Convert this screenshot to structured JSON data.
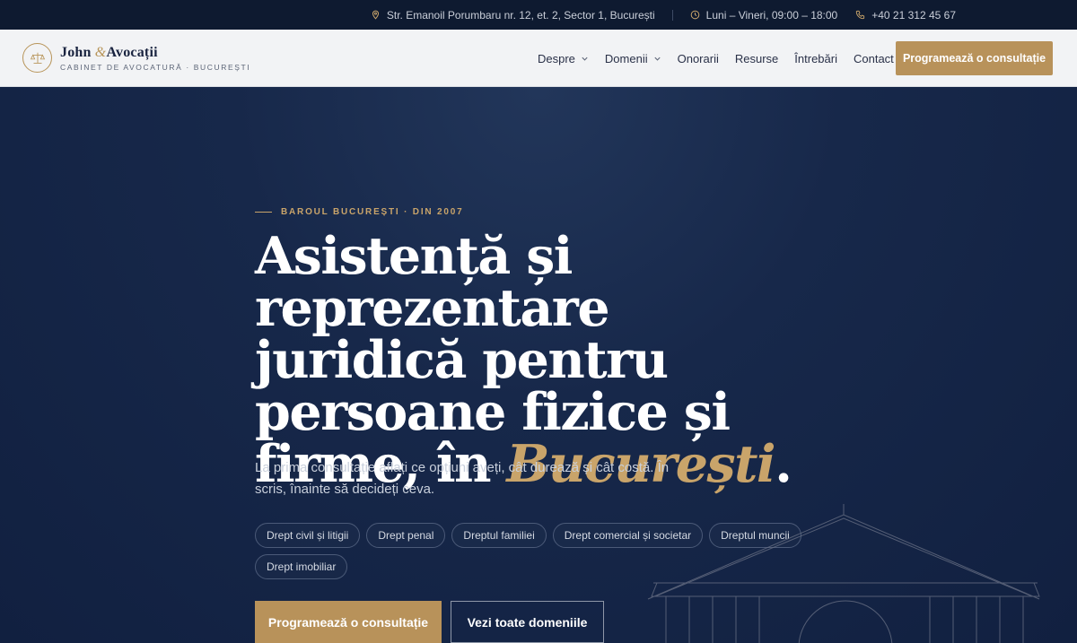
{
  "topbar": {
    "address": "Str. Emanoil Porumbaru nr. 12, et. 2, Sector 1, București",
    "hours": "Luni – Vineri, 09:00 – 18:00",
    "phone": "+40 21 312 45 67"
  },
  "brand": {
    "name_first": "John ",
    "name_amp": "&",
    "name_last": "Avocații",
    "tagline": "CABINET DE AVOCATURĂ · BUCUREȘTI"
  },
  "nav": {
    "items": [
      {
        "label": "Despre",
        "has_dropdown": true
      },
      {
        "label": "Domenii",
        "has_dropdown": true
      },
      {
        "label": "Onorarii",
        "has_dropdown": false
      },
      {
        "label": "Resurse",
        "has_dropdown": false
      },
      {
        "label": "Întrebări",
        "has_dropdown": false
      },
      {
        "label": "Contact",
        "has_dropdown": false
      }
    ],
    "cta": "Programează o consultație"
  },
  "hero": {
    "eyebrow": "BAROUL BUCUREȘTI · DIN 2007",
    "headline_main": "Asistență și reprezentare juridică pentru persoane fizice și firme, în ",
    "headline_accent": "București",
    "headline_end": ".",
    "lead": "La prima consultație aflați ce opțiuni aveți, cât durează și cât costă. În scris, înainte să decideți ceva.",
    "chips": [
      "Drept civil și litigii",
      "Drept penal",
      "Dreptul familiei",
      "Drept comercial și societar",
      "Dreptul muncii",
      "Drept imobiliar"
    ],
    "primary_button": "Programează o consultație",
    "secondary_button": "Vezi toate domeniile"
  },
  "colors": {
    "accent": "#b8925a",
    "navy": "#0f1d36",
    "header_bg": "#f2f3f5"
  }
}
